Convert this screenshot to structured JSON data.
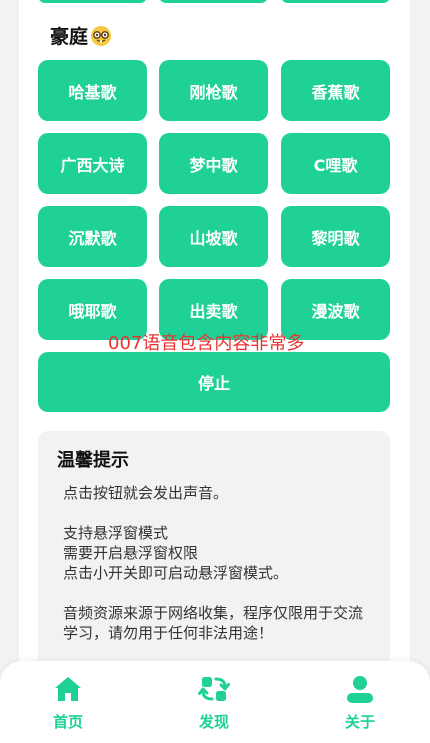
{
  "section": {
    "title": "豪庭",
    "emoji": "nerd-face-emoji"
  },
  "buttons": [
    [
      "哈基歌",
      "刚枪歌",
      "香蕉歌"
    ],
    [
      "广西大诗",
      "梦中歌",
      "C哩歌"
    ],
    [
      "沉默歌",
      "山坡歌",
      "黎明歌"
    ],
    [
      "哦耶歌",
      "出卖歌",
      "漫波歌"
    ]
  ],
  "stop_label": "停止",
  "overlay": "007语音包含内容非常多",
  "tips": {
    "title": "温馨提示",
    "body": "点击按钮就会发出声音。\n\n支持悬浮窗模式\n需要开启悬浮窗权限\n点击小开关即可启动悬浮窗模式。\n\n音频资源来源于网络收集，程序仅限用于交流学习，请勿用于任何非法用途！"
  },
  "nav": {
    "items": [
      {
        "label": "首页",
        "icon": "home-icon"
      },
      {
        "label": "发现",
        "icon": "refresh-icon"
      },
      {
        "label": "关于",
        "icon": "user-icon"
      }
    ]
  },
  "colors": {
    "accent": "#1fd196",
    "overlay_text": "#e8332f",
    "background": "#f1f2f4"
  }
}
